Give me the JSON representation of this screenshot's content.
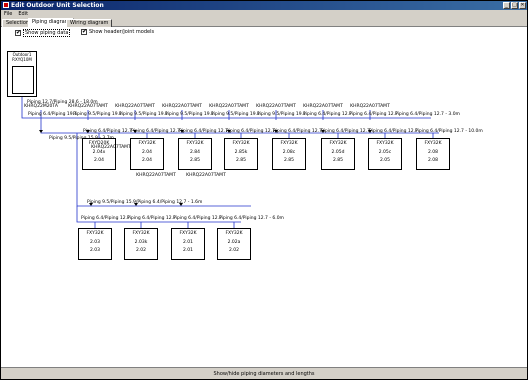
{
  "window": {
    "title": "Edit Outdoor Unit Selection",
    "controls": [
      "_",
      "□",
      "✕"
    ]
  },
  "menu": {
    "items": [
      "File",
      "Edit"
    ]
  },
  "tabs": [
    {
      "label": "Selection",
      "active": false
    },
    {
      "label": "Piping diagram",
      "active": true
    },
    {
      "label": "Wiring diagram",
      "active": false
    }
  ],
  "options": {
    "show_piping_data": {
      "label": "Show piping data",
      "checked": true
    },
    "show_header_joint_models": {
      "label": "Show header/joint models",
      "checked": true
    }
  },
  "outdoor_unit": {
    "label": "Outdoor1",
    "model": "RXYQ10M"
  },
  "main_pipe": "Piping 12.7/Piping 28.6 - 18.0m",
  "top_joints": [
    "KHRQ22M20TA",
    "KHRQ22A07TAMT",
    "KHRQ22A07TAMT",
    "KHRQ22A07TAMT",
    "KHRQ22A07TAMT",
    "KHRQ22A07TAMT",
    "KHRQ22A07TAMT",
    "KHRQ22A07TAMT"
  ],
  "top_header_pipes": [
    "Piping 6.4/Piping 19.1",
    "Piping 9.5/Piping 19.1",
    "Piping 9.5/Piping 19.1",
    "Piping 9.5/Piping 19.1",
    "Piping 9.5/Piping 19.1",
    "Piping 9.5/Piping 19.1",
    "Piping 6.4/Piping 12.7",
    "Piping 6.4/Piping 12.7",
    "Piping 6.4/Piping 12.7 - 3.0m"
  ],
  "top_branch_pipes": [
    "Piping 6.4/Piping 12.7",
    "Piping 6.4/Piping 12.7",
    "Piping 6.4/Piping 12.7",
    "Piping 6.4/Piping 12.7",
    "Piping 6.4/Piping 12.7",
    "Piping 6.4/Piping 12.7",
    "Piping 6.4/Piping 12.7",
    "Piping 6.4/Piping 12.7 - 10.0m"
  ],
  "side_pipe": "Piping 9.5/Piping 15.9 - 3.7m",
  "top_units": [
    {
      "model": "FXYD20K",
      "v1": "2.04x",
      "v2": "2.04"
    },
    {
      "model": "FXY32K",
      "v1": "2.04",
      "v2": "2.04"
    },
    {
      "model": "FXY32K",
      "v1": "2.84",
      "v2": "2.85"
    },
    {
      "model": "FXY32K",
      "v1": "2.85k",
      "v2": "2.85"
    },
    {
      "model": "FXY32K",
      "v1": "2.08c",
      "v2": "2.85"
    },
    {
      "model": "FXY32K",
      "v1": "2.05d",
      "v2": "2.85"
    },
    {
      "model": "FXY32K",
      "v1": "2.05c",
      "v2": "2.05"
    },
    {
      "model": "FXY32K",
      "v1": "2.08",
      "v2": "2.08"
    }
  ],
  "bottom_joints": [
    "KHRQ22A07TAMT",
    "KHRQ22A07TAMT",
    "KHRQ22A07TAMT"
  ],
  "bottom_header_pipe": "Piping 9.5/Piping 15.9/Piping 6.4/Piping 12.7 - 1.6m",
  "bottom_branch_pipes": [
    "Piping 6.4/Piping 12.7",
    "Piping 6.4/Piping 12.7",
    "Piping 6.4/Piping 12.7",
    "Piping 6.4/Piping 12.7 - 6.0m"
  ],
  "bottom_units": [
    {
      "model": "FXY32K",
      "v1": "2.03",
      "v2": "2.03"
    },
    {
      "model": "FXY32K",
      "v1": "2.03k",
      "v2": "2.02"
    },
    {
      "model": "FXY32K",
      "v1": "2.01",
      "v2": "2.01"
    },
    {
      "model": "FXY32K",
      "v1": "2.02a",
      "v2": "2.02"
    }
  ],
  "status": "Show/hide piping diameters and lengths"
}
